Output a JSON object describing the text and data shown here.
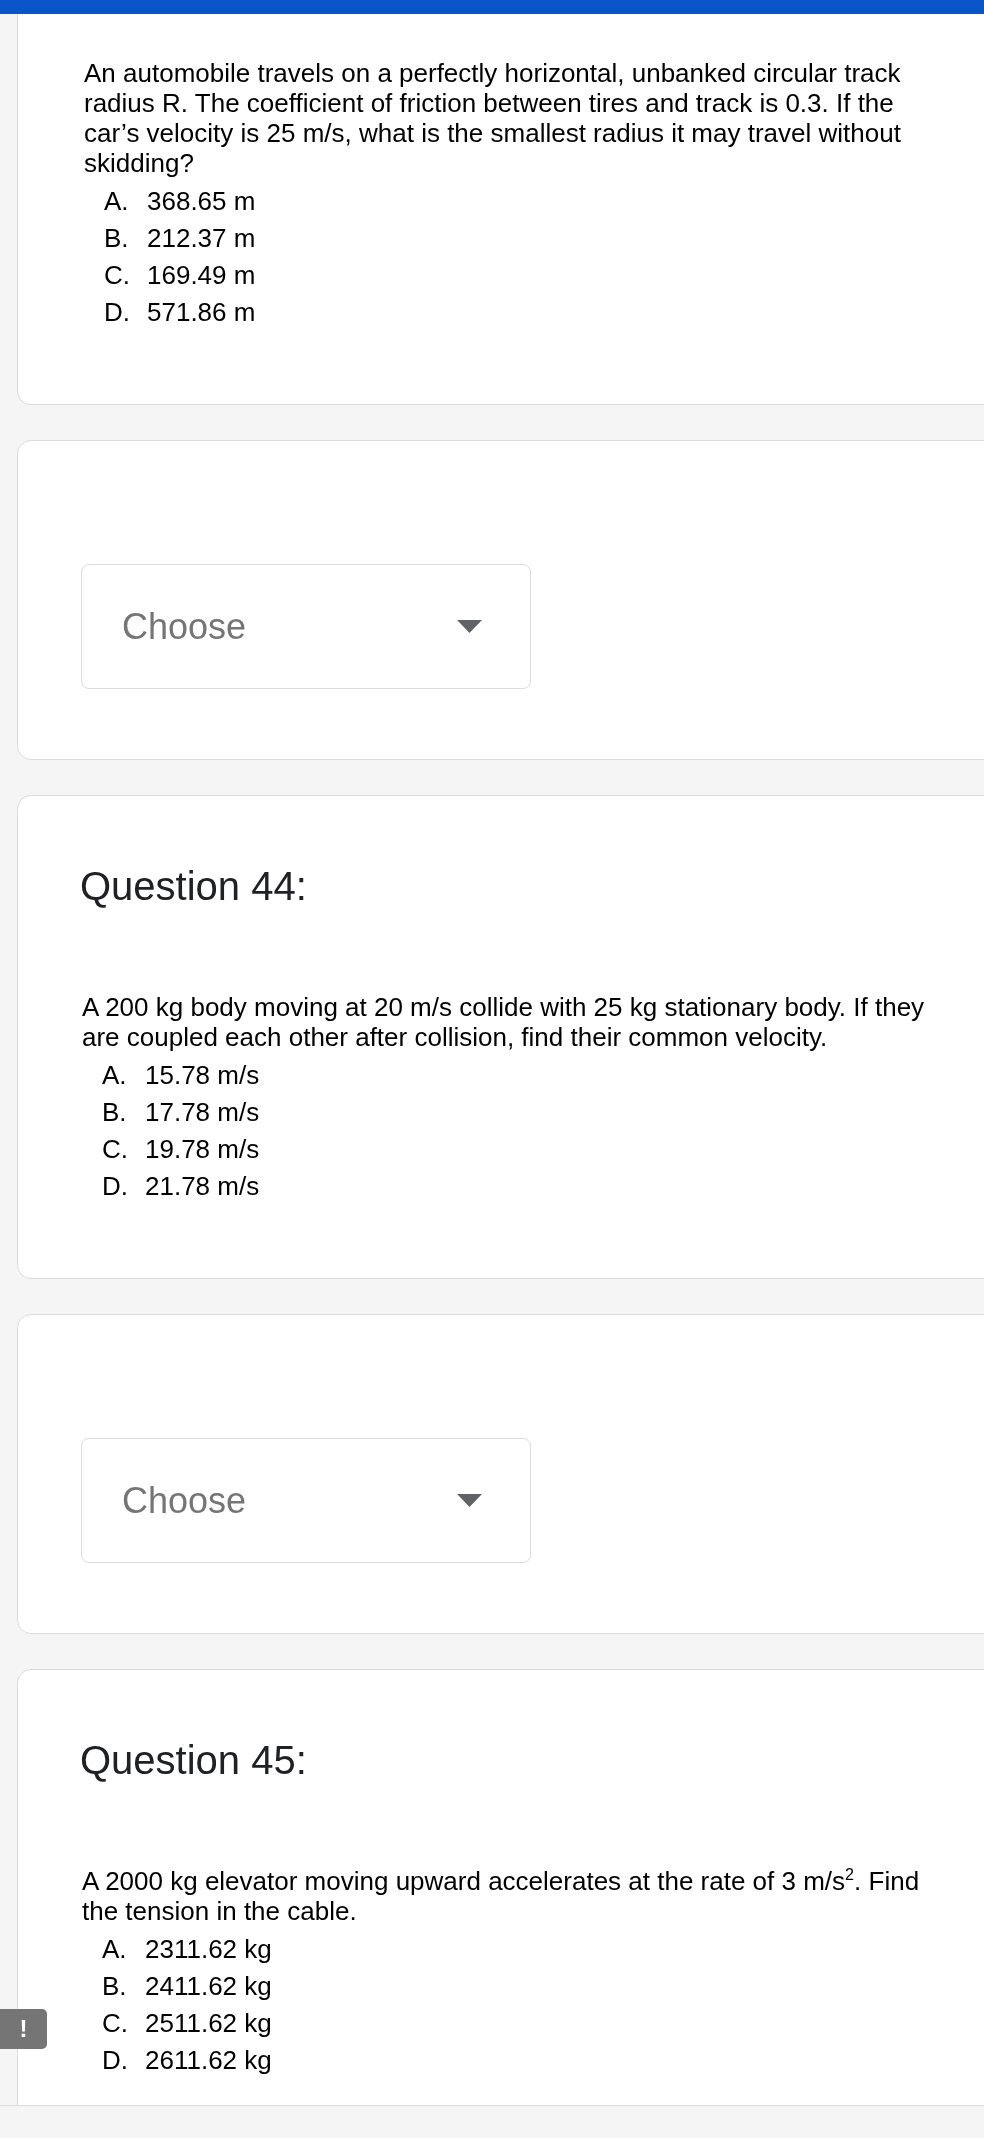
{
  "cards": [
    {
      "kind": "question",
      "text": "An automobile travels on a perfectly horizontal, unbanked circular track radius R. The coefficient of friction between tires and track is 0.3. If the car’s velocity is 25 m/s, what is the smallest radius it may travel without skidding?",
      "options": [
        {
          "letter": "A.",
          "text": "368.65 m"
        },
        {
          "letter": "B.",
          "text": "212.37 m"
        },
        {
          "letter": "C.",
          "text": "169.49 m"
        },
        {
          "letter": "D.",
          "text": "571.86 m"
        }
      ]
    },
    {
      "kind": "dropdown",
      "placeholder": "Choose"
    },
    {
      "kind": "question",
      "heading": "Question 44:",
      "text": "A 200 kg body moving at 20 m/s collide with 25 kg stationary body. If they are coupled each other after collision, find their common velocity.",
      "options": [
        {
          "letter": "A.",
          "text": "15.78 m/s"
        },
        {
          "letter": "B.",
          "text": "17.78 m/s"
        },
        {
          "letter": "C.",
          "text": "19.78 m/s"
        },
        {
          "letter": "D.",
          "text": "21.78 m/s"
        }
      ]
    },
    {
      "kind": "dropdown",
      "placeholder": "Choose"
    },
    {
      "kind": "question",
      "heading": "Question 45:",
      "text": "A 2000 kg elevator moving upward accelerates at the rate of 3 m/s$^{2}$. Find the tension in the cable.",
      "options": [
        {
          "letter": "A.",
          "text": "2311.62 kg"
        },
        {
          "letter": "B.",
          "text": "2411.62 kg"
        },
        {
          "letter": "C.",
          "text": "2511.62 kg"
        },
        {
          "letter": "D.",
          "text": "2611.62 kg"
        }
      ]
    }
  ],
  "feedback_button": {
    "label": "!"
  }
}
